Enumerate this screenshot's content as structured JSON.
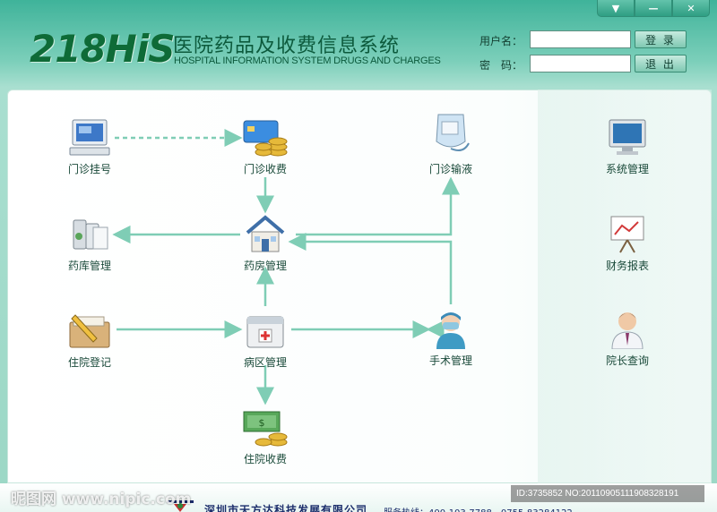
{
  "window_controls": [
    {
      "name": "dropdown",
      "glyph": "▼"
    },
    {
      "name": "minimize",
      "glyph": "—"
    },
    {
      "name": "close",
      "glyph": "✕"
    }
  ],
  "header": {
    "logo_text": "218HiS",
    "title_cn": "医院药品及收费信息系统",
    "title_en": "HOSPITAL INFORMATION SYSTEM DRUGS AND CHARGES"
  },
  "login": {
    "username_label": "用户名：",
    "password_label": "密　码：",
    "username_value": "",
    "password_value": "",
    "login_button": "登 录",
    "logout_button": "退 出"
  },
  "modules": {
    "outpatient_register": "门诊挂号",
    "outpatient_charge": "门诊收费",
    "outpatient_infusion": "门诊输液",
    "drug_storage": "药库管理",
    "pharmacy": "药房管理",
    "inpatient_register": "住院登记",
    "ward": "病区管理",
    "surgery": "手术管理",
    "inpatient_charge": "住院收费",
    "system": "系统管理",
    "finance": "财务报表",
    "director": "院长查询"
  },
  "footer": {
    "company": "深圳市天方达科技发展有限公司",
    "hotline": "服务热线：400-103-7788　0755-83284122",
    "watermark": "昵图网 www.nipic.com",
    "id_text": "ID:3735852 NO:20110905111908328191"
  },
  "colors": {
    "accent": "#2f9e83",
    "link_line": "#7fcdb5"
  }
}
